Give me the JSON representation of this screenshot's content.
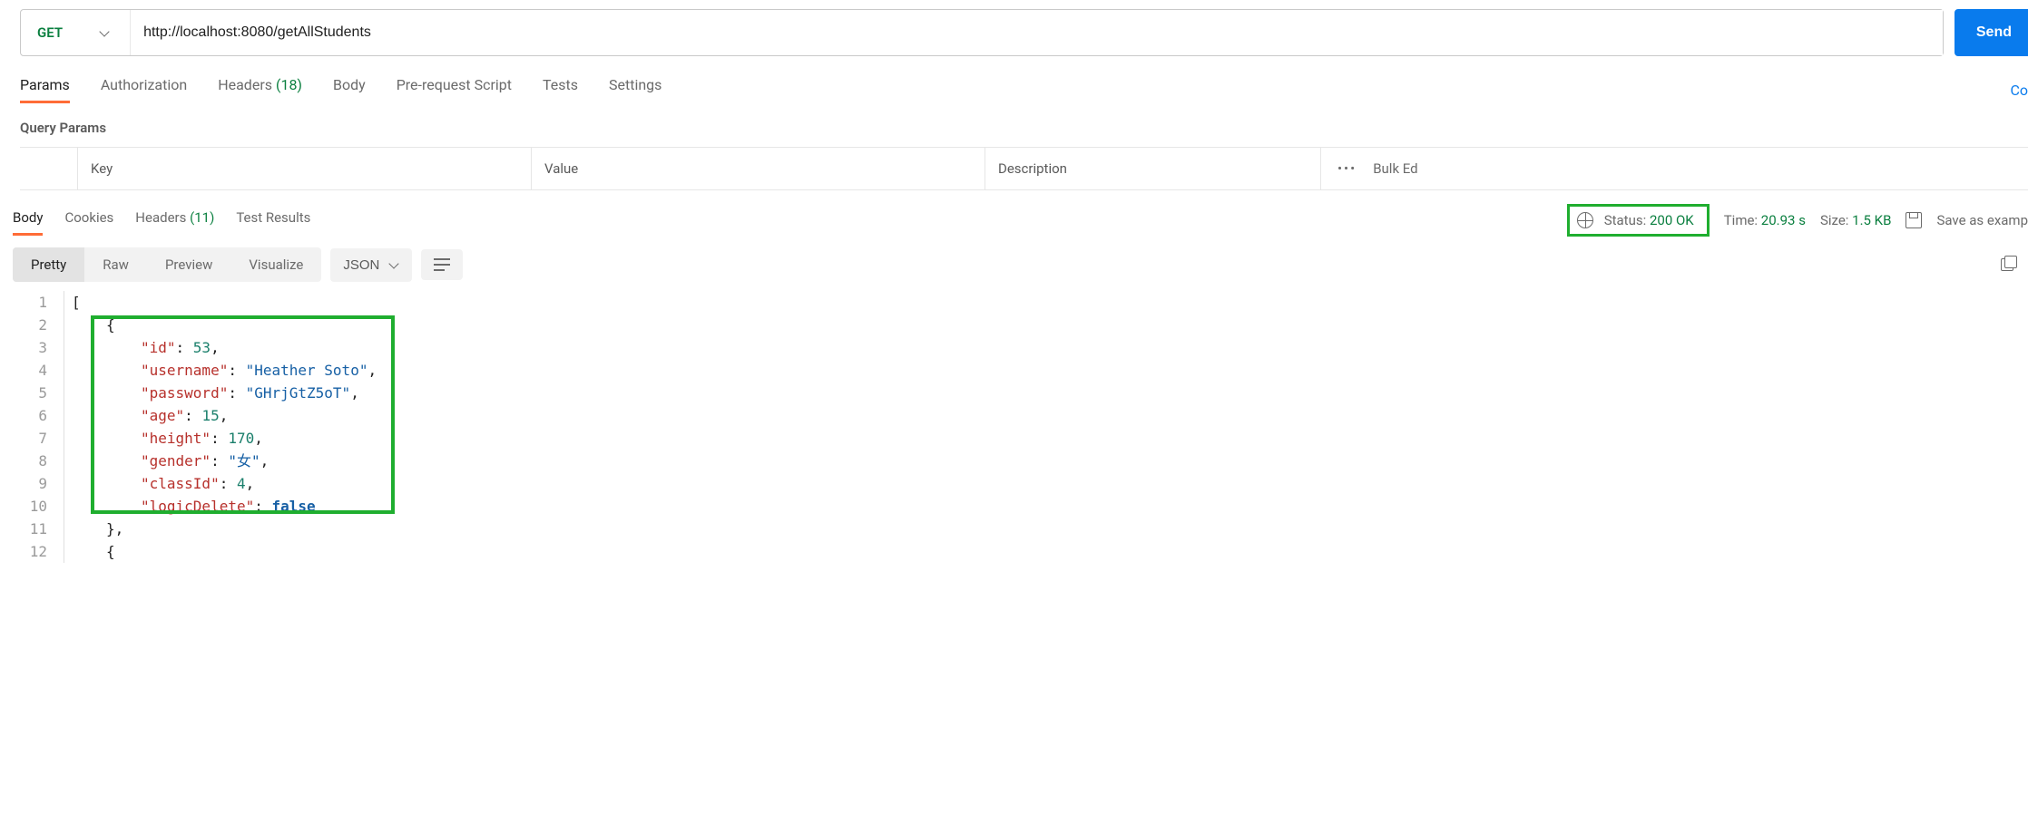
{
  "request": {
    "method": "GET",
    "url": "http://localhost:8080/getAllStudents",
    "send_label": "Send"
  },
  "req_tabs": {
    "params": "Params",
    "auth": "Authorization",
    "headers_label": "Headers",
    "headers_count": "(18)",
    "body": "Body",
    "prereq": "Pre-request Script",
    "tests": "Tests",
    "settings": "Settings",
    "right_action": "Co"
  },
  "query_params": {
    "title": "Query Params",
    "key": "Key",
    "value": "Value",
    "description": "Description",
    "more": "•••",
    "bulk": "Bulk Ed"
  },
  "response": {
    "tabs": {
      "body": "Body",
      "cookies": "Cookies",
      "headers_label": "Headers",
      "headers_count": "(11)",
      "test_results": "Test Results"
    },
    "status_label": "Status:",
    "status_value": "200 OK",
    "time_label": "Time:",
    "time_value": "20.93 s",
    "size_label": "Size:",
    "size_value": "1.5 KB",
    "save_label": "Save as examp"
  },
  "body_controls": {
    "pretty": "Pretty",
    "raw": "Raw",
    "preview": "Preview",
    "visualize": "Visualize",
    "format": "JSON"
  },
  "code": {
    "lines": [
      {
        "n": "1",
        "indent": 0,
        "tokens": [
          [
            "b",
            "["
          ]
        ]
      },
      {
        "n": "2",
        "indent": 1,
        "tokens": [
          [
            "b",
            "{"
          ]
        ]
      },
      {
        "n": "3",
        "indent": 2,
        "tokens": [
          [
            "k",
            "\"id\""
          ],
          [
            "p",
            ": "
          ],
          [
            "n",
            "53"
          ],
          [
            "p",
            ","
          ]
        ]
      },
      {
        "n": "4",
        "indent": 2,
        "tokens": [
          [
            "k",
            "\"username\""
          ],
          [
            "p",
            ": "
          ],
          [
            "s",
            "\"Heather Soto\""
          ],
          [
            "p",
            ","
          ]
        ]
      },
      {
        "n": "5",
        "indent": 2,
        "tokens": [
          [
            "k",
            "\"password\""
          ],
          [
            "p",
            ": "
          ],
          [
            "s",
            "\"GHrjGtZ5oT\""
          ],
          [
            "p",
            ","
          ]
        ]
      },
      {
        "n": "6",
        "indent": 2,
        "tokens": [
          [
            "k",
            "\"age\""
          ],
          [
            "p",
            ": "
          ],
          [
            "n",
            "15"
          ],
          [
            "p",
            ","
          ]
        ]
      },
      {
        "n": "7",
        "indent": 2,
        "tokens": [
          [
            "k",
            "\"height\""
          ],
          [
            "p",
            ": "
          ],
          [
            "n",
            "170"
          ],
          [
            "p",
            ","
          ]
        ]
      },
      {
        "n": "8",
        "indent": 2,
        "tokens": [
          [
            "k",
            "\"gender\""
          ],
          [
            "p",
            ": "
          ],
          [
            "s",
            "\"女\""
          ],
          [
            "p",
            ","
          ]
        ]
      },
      {
        "n": "9",
        "indent": 2,
        "tokens": [
          [
            "k",
            "\"classId\""
          ],
          [
            "p",
            ": "
          ],
          [
            "n",
            "4"
          ],
          [
            "p",
            ","
          ]
        ]
      },
      {
        "n": "10",
        "indent": 2,
        "tokens": [
          [
            "k",
            "\"logicDelete\""
          ],
          [
            "p",
            ": "
          ],
          [
            "bool",
            "false"
          ]
        ]
      },
      {
        "n": "11",
        "indent": 1,
        "tokens": [
          [
            "b",
            "}"
          ],
          [
            "p",
            ","
          ]
        ]
      },
      {
        "n": "12",
        "indent": 1,
        "tokens": [
          [
            "b",
            "{"
          ]
        ]
      }
    ]
  }
}
